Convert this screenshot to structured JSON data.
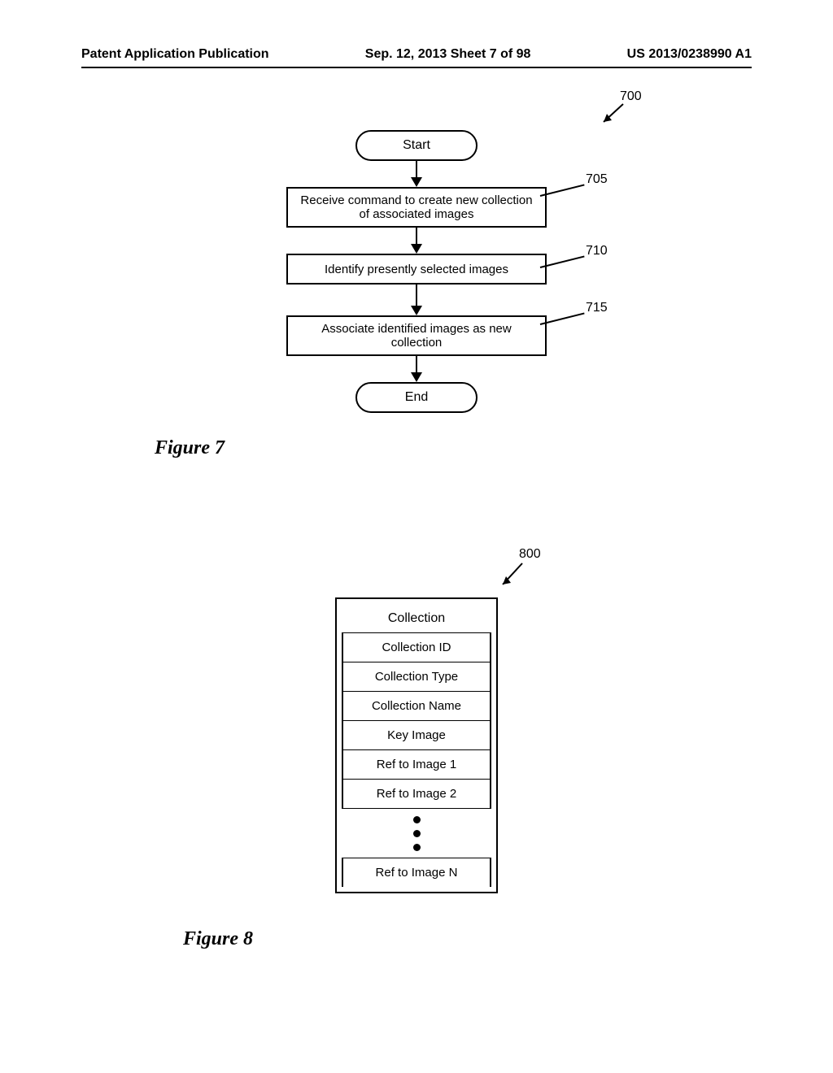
{
  "header": {
    "left": "Patent Application Publication",
    "center": "Sep. 12, 2013  Sheet 7 of 98",
    "right": "US 2013/0238990 A1"
  },
  "figure7": {
    "ref_700": "700",
    "start": "Start",
    "step_705": {
      "label": "705",
      "text": "Receive command to create new collection of associated images"
    },
    "step_710": {
      "label": "710",
      "text": "Identify presently selected images"
    },
    "step_715": {
      "label": "715",
      "text": "Associate identified images as new collection"
    },
    "end": "End",
    "caption": "Figure 7"
  },
  "figure8": {
    "ref_800": "800",
    "title": "Collection",
    "rows": {
      "r1": "Collection ID",
      "r2": "Collection Type",
      "r3": "Collection Name",
      "r4": "Key Image",
      "r5": "Ref to Image 1",
      "r6": "Ref to Image 2",
      "last": "Ref to Image N"
    },
    "caption": "Figure 8"
  }
}
